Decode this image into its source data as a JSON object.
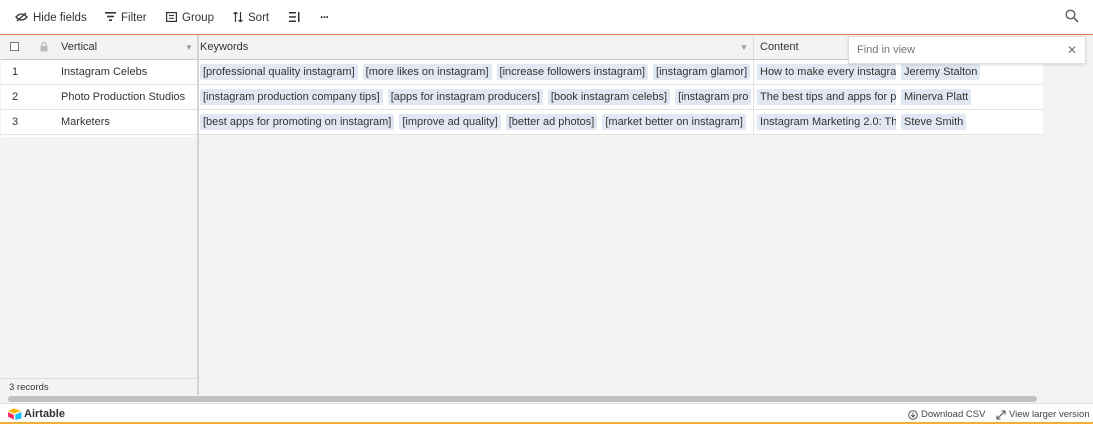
{
  "toolbar": {
    "hide_fields": "Hide fields",
    "filter": "Filter",
    "group": "Group",
    "sort": "Sort",
    "more": "···"
  },
  "grid": {
    "primary_field": "Vertical",
    "columns": [
      "Keywords",
      "Content"
    ],
    "rows": [
      {
        "num": "1",
        "vertical": "Instagram Celebs",
        "keywords": [
          "[professional quality instagram]",
          "[more likes on instagram]",
          "[increase followers instagram]",
          "[instagram glamor]"
        ],
        "content": "How to make every instagra",
        "author": "Jeremy Stalton"
      },
      {
        "num": "2",
        "vertical": "Photo Production Studios",
        "keywords": [
          "[instagram production company tips]",
          "[apps for instagram producers]",
          "[book instagram celebs]",
          "[instagram pro"
        ],
        "content": "The best tips and apps for p",
        "author": "Minerva Platt"
      },
      {
        "num": "3",
        "vertical": "Marketers",
        "keywords": [
          "[best apps for promoting on instagram]",
          "[improve ad quality]",
          "[better ad photos]",
          "[market better on instagram]"
        ],
        "content": "Instagram Marketing 2.0: Th",
        "author": "Steve Smith"
      }
    ],
    "record_count": "3 records"
  },
  "search": {
    "placeholder": "Find in view"
  },
  "footer": {
    "brand": "Airtable",
    "download": "Download CSV",
    "view_larger": "View larger version"
  },
  "colors": {
    "accent_line": "#e8764f",
    "chip_bg": "#e2e8f3",
    "footer_stripe": "#f0b03c"
  }
}
